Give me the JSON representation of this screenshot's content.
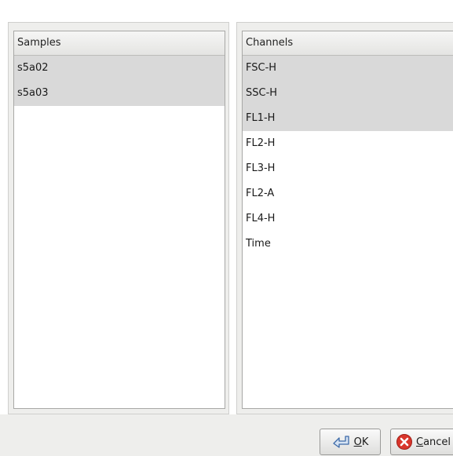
{
  "samples": {
    "header": "Samples",
    "items": [
      {
        "label": "s5a02",
        "selected": true
      },
      {
        "label": "s5a03",
        "selected": true
      }
    ]
  },
  "channels": {
    "header": "Channels",
    "items": [
      {
        "label": "FSC-H",
        "selected": true
      },
      {
        "label": "SSC-H",
        "selected": true
      },
      {
        "label": "FL1-H",
        "selected": true
      },
      {
        "label": "FL2-H",
        "selected": false
      },
      {
        "label": "FL3-H",
        "selected": false
      },
      {
        "label": "FL2-A",
        "selected": false
      },
      {
        "label": "FL4-H",
        "selected": false
      },
      {
        "label": "Time",
        "selected": false
      }
    ]
  },
  "buttons": {
    "ok_mnemonic": "O",
    "ok_rest": "K",
    "ok_icon": "ok-icon",
    "cancel_mnemonic": "C",
    "cancel_rest": "ancel",
    "cancel_icon": "cancel-icon",
    "cancel_icon_color": "#d9352b"
  }
}
